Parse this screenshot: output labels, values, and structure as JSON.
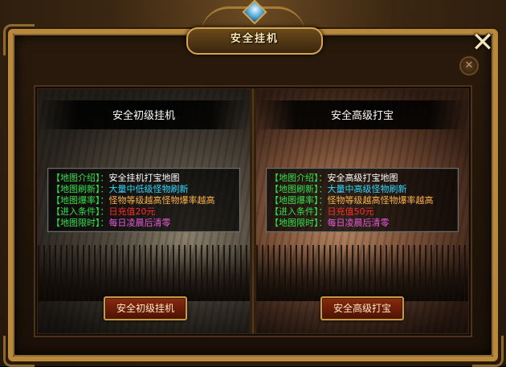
{
  "window": {
    "title": "安全挂机",
    "close_symbol": "✕",
    "close_secondary_symbol": "✕"
  },
  "panels": [
    {
      "title": "安全初级挂机",
      "info": [
        {
          "key": "【地图介绍】",
          "sep": "：",
          "value": "安全挂机打宝地图",
          "color": "white"
        },
        {
          "key": "【地图刷新】",
          "sep": "：",
          "value": "大量中低级怪物刷新",
          "color": "cyan"
        },
        {
          "key": "【地图爆率】",
          "sep": "：",
          "value": "怪物等级越高怪物爆率越高",
          "color": "orange"
        },
        {
          "key": "【进入条件】",
          "sep": "：",
          "value": "日充值20元",
          "color": "red"
        },
        {
          "key": "【地图限时】",
          "sep": "：",
          "value": "每日凌晨后清零",
          "color": "pink"
        }
      ],
      "button_label": "安全初级挂机"
    },
    {
      "title": "安全高级打宝",
      "info": [
        {
          "key": "【地图介绍】",
          "sep": "：",
          "value": "安全高级打宝地图",
          "color": "white"
        },
        {
          "key": "【地图刷新】",
          "sep": "：",
          "value": "大量中高级怪物刷新",
          "color": "cyan"
        },
        {
          "key": "【地图爆率】",
          "sep": "：",
          "value": "怪物等级越高怪物爆率越高",
          "color": "orange"
        },
        {
          "key": "【进入条件】",
          "sep": "：",
          "value": "日充值50元",
          "color": "red"
        },
        {
          "key": "【地图限时】",
          "sep": "：",
          "value": "每日凌晨后清零",
          "color": "pink"
        }
      ],
      "button_label": "安全高级打宝"
    }
  ],
  "colors": {
    "key": "#33e04a",
    "white": "#ffffff",
    "cyan": "#2fd8ff",
    "orange": "#ffb34a",
    "red": "#ff2b2b",
    "pink": "#e85adf",
    "gold_frame": "#b8893b"
  },
  "icons": {
    "close": "close-icon",
    "close_secondary": "close-circle-icon",
    "gem": "gem-icon"
  }
}
